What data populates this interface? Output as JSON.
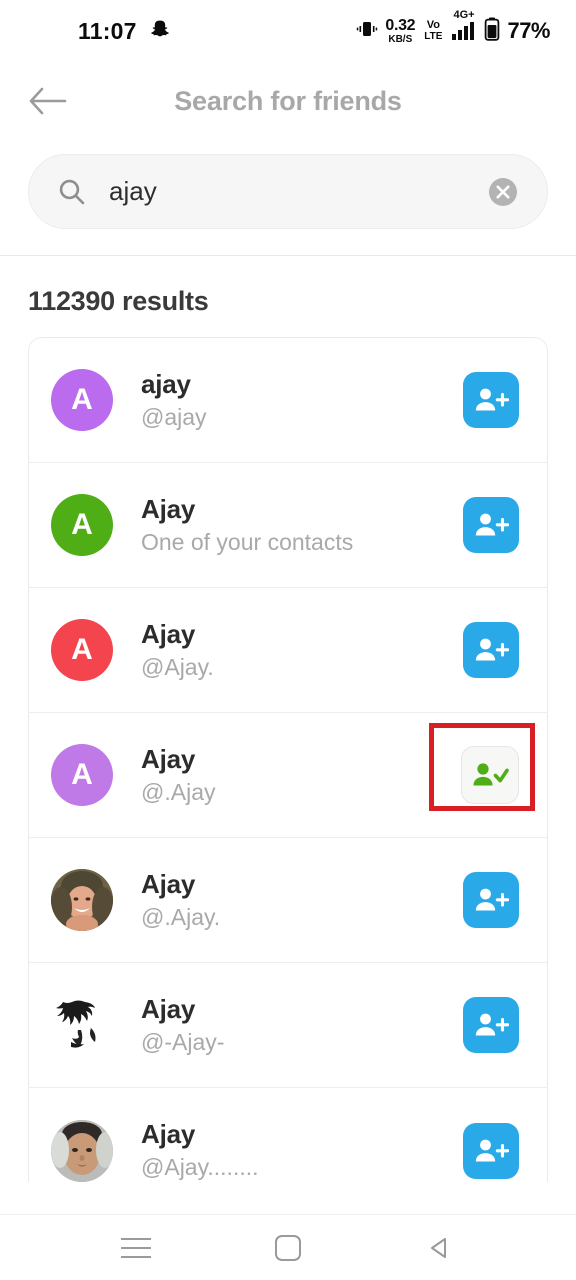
{
  "status_bar": {
    "time": "11:07",
    "app_icon": "snapchat-ghost-icon",
    "vibrate_icon": "vibrate-icon",
    "net_speed_value": "0.32",
    "net_speed_unit": "KB/S",
    "volte_top": "Vo",
    "volte_bottom": "LTE",
    "network_type": "4G+",
    "signal_bars": 4,
    "battery_percent": "77%"
  },
  "header": {
    "title": "Search for friends",
    "back_icon": "back-arrow-icon"
  },
  "search": {
    "value": "ajay",
    "placeholder": "Search",
    "search_icon": "search-icon",
    "clear_icon": "clear-circle-icon"
  },
  "results": {
    "count_label": "112390 results",
    "rows": [
      {
        "name": "ajay",
        "subtitle": "@ajay",
        "avatar_type": "letter",
        "avatar_letter": "A",
        "avatar_color": "#bb6bed",
        "action": "add",
        "highlighted": false
      },
      {
        "name": "Ajay",
        "subtitle": "One of your contacts",
        "avatar_type": "letter",
        "avatar_letter": "A",
        "avatar_color": "#4fae15",
        "action": "add",
        "highlighted": false
      },
      {
        "name": "Ajay",
        "subtitle": "@Ajay.",
        "avatar_type": "letter",
        "avatar_letter": "A",
        "avatar_color": "#f4454e",
        "action": "add",
        "highlighted": false
      },
      {
        "name": "Ajay",
        "subtitle": "@.Ajay",
        "avatar_type": "letter",
        "avatar_letter": "A",
        "avatar_color": "#c07ae8",
        "action": "added",
        "highlighted": true
      },
      {
        "name": "Ajay",
        "subtitle": "@.Ajay.",
        "avatar_type": "photo-child",
        "avatar_letter": "",
        "avatar_color": "#c9a98d",
        "action": "add",
        "highlighted": false
      },
      {
        "name": "Ajay",
        "subtitle": "@-Ajay-",
        "avatar_type": "photo-dark-art",
        "avatar_letter": "",
        "avatar_color": "#ffffff",
        "action": "add",
        "highlighted": false
      },
      {
        "name": "Ajay",
        "subtitle": "@Ajay........",
        "avatar_type": "photo-face",
        "avatar_letter": "",
        "avatar_color": "#c6a184",
        "action": "add",
        "highlighted": false
      }
    ]
  },
  "nav_bar": {
    "recents_icon": "menu-icon",
    "home_icon": "home-square-icon",
    "back_icon": "back-triangle-icon"
  },
  "colors": {
    "add_button": "#29a9e8",
    "added_button_icon": "#4fae15",
    "highlight_box": "#d81f26",
    "header_title": "#a8a8a8"
  }
}
